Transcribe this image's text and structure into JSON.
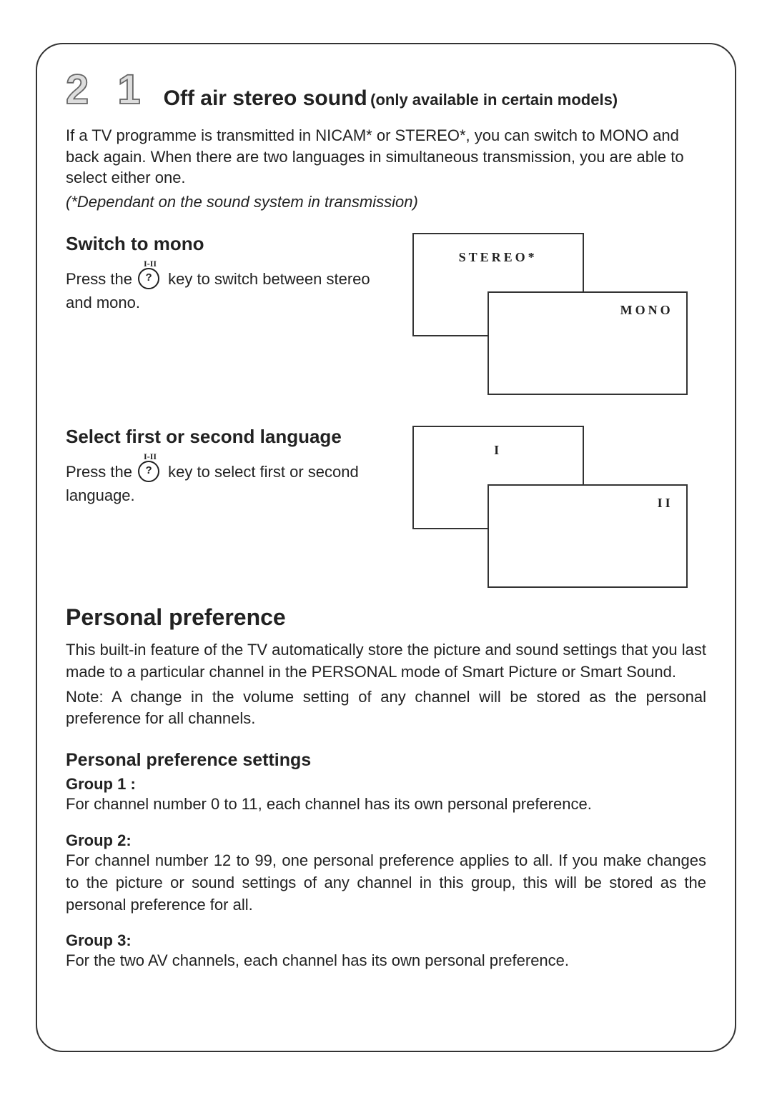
{
  "pageNumber": "2 1",
  "section1": {
    "title": "Off air stereo sound",
    "titleNote": "(only available in certain models)",
    "intro": "If a TV programme is transmitted in NICAM* or STEREO*, you can switch to MONO and back again.  When there are two languages in simultaneous transmission, you are able to select either one.",
    "introNote": "(*Dependant on the sound system in transmission)",
    "sub1": {
      "heading": "Switch to mono",
      "preText": "Press the ",
      "postText": " key to switch between stereo and mono.",
      "keySup": "I-II",
      "keyGlyph": "?",
      "boxA": "STEREO*",
      "boxB": "MONO"
    },
    "sub2": {
      "heading": "Select first or second language",
      "preText": "Press the ",
      "postText": " key to select first or second language.",
      "keySup": "I-II",
      "keyGlyph": "?",
      "boxA": "I",
      "boxB": "II"
    }
  },
  "section2": {
    "title": "Personal preference",
    "body": "This built-in feature of the TV automatically store the picture and sound settings that you last made to a particular channel in the PERSONAL mode of Smart Picture or Smart Sound.",
    "note": "Note: A change in the volume setting of any channel will be stored as the personal preference for all channels.",
    "settingsHeading": "Personal preference settings",
    "groups": [
      {
        "label": "Group 1 :",
        "text": "For channel number 0 to 11, each channel has its own personal preference."
      },
      {
        "label": "Group 2:",
        "text": "For channel number 12 to 99, one personal preference applies to all.  If you make changes to the picture or sound settings of any channel in this group, this will be stored as the personal preference for all."
      },
      {
        "label": "Group 3:",
        "text": "For the two AV channels, each channel has its own personal preference."
      }
    ]
  }
}
